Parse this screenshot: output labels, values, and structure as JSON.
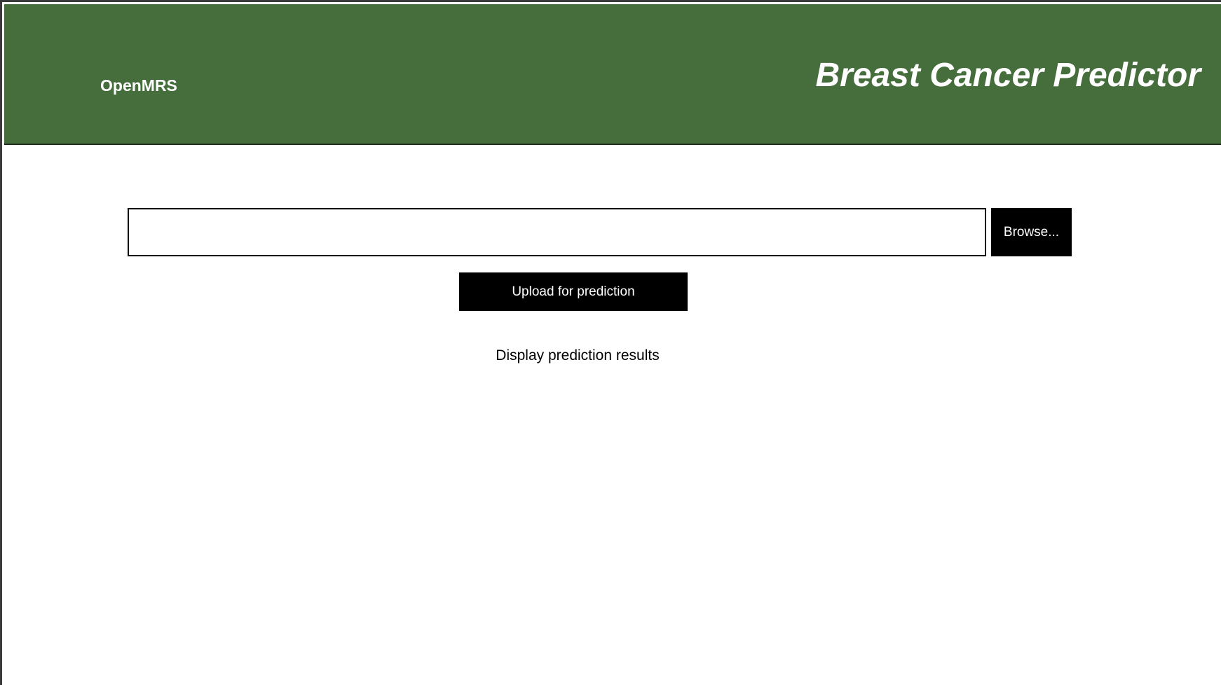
{
  "header": {
    "brand": "OpenMRS",
    "title": "Breast Cancer Predictor"
  },
  "upload": {
    "file_value": "",
    "browse_label": "Browse...",
    "submit_label": "Upload for prediction"
  },
  "results": {
    "text": "Display prediction results"
  },
  "colors": {
    "header_bg": "#456e3c",
    "button_bg": "#000000",
    "button_text": "#ffffff"
  }
}
